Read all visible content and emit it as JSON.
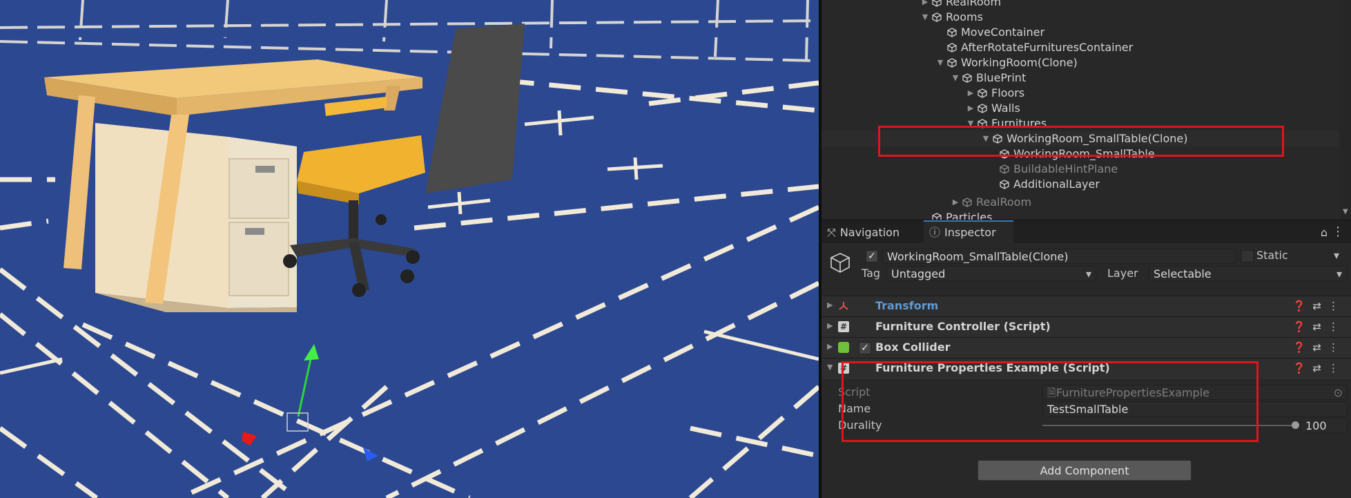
{
  "hierarchy": {
    "rows": [
      {
        "label": "RealRoom",
        "dim": false
      },
      {
        "label": "Rooms",
        "dim": false
      },
      {
        "label": "MoveContainer",
        "dim": false
      },
      {
        "label": "AfterRotateFurnituresContainer",
        "dim": false
      },
      {
        "label": "WorkingRoom(Clone)",
        "dim": false
      },
      {
        "label": "BluePrint",
        "dim": false
      },
      {
        "label": "Floors",
        "dim": false
      },
      {
        "label": "Walls",
        "dim": false
      },
      {
        "label": "Furnitures",
        "dim": false
      },
      {
        "label": "WorkingRoom_SmallTable(Clone)",
        "dim": false
      },
      {
        "label": "WorkingRoom_SmallTable",
        "dim": false
      },
      {
        "label": "BuildableHintPlane",
        "dim": true
      },
      {
        "label": "AdditionalLayer",
        "dim": false
      },
      {
        "label": "RealRoom",
        "dim": true
      },
      {
        "label": "Particles",
        "dim": false
      }
    ]
  },
  "tabs": {
    "navigation": "Navigation",
    "inspector": "Inspector"
  },
  "inspector": {
    "object_name": "WorkingRoom_SmallTable(Clone)",
    "static_label": "Static",
    "tag_label": "Tag",
    "tag_value": "Untagged",
    "layer_label": "Layer",
    "layer_value": "Selectable",
    "components": {
      "transform": "Transform",
      "furniture_controller": "Furniture Controller (Script)",
      "box_collider": "Box Collider",
      "furniture_properties": "Furniture Properties Example (Script)"
    },
    "properties": {
      "script_label": "Script",
      "script_value": "FurniturePropertiesExample",
      "name_label": "Name",
      "name_value": "TestSmallTable",
      "durality_label": "Durality",
      "durality_value": "100",
      "durality_fraction": 1.0
    },
    "add_component": "Add Component"
  },
  "colors": {
    "floor": "#2b4891",
    "selection_box": "#e0141b",
    "transform_link": "#5e9bd6"
  },
  "icons": {
    "hierarchy_object": "cube-icon",
    "navigation_tab": "navigation-icon",
    "inspector_tab": "info-icon",
    "lock": "lock-icon",
    "help": "help-icon",
    "presets": "sliders-icon",
    "more": "kebab-icon"
  }
}
